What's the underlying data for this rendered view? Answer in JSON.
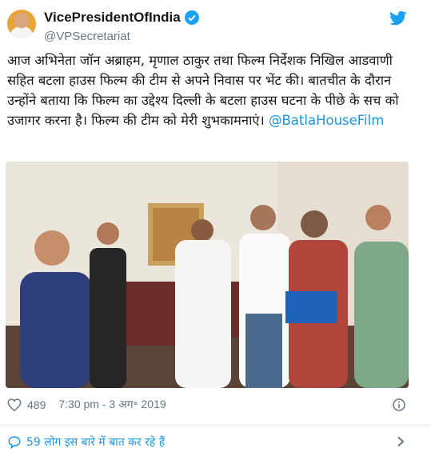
{
  "author": {
    "display_name": "VicePresidentOfIndia",
    "handle": "@VPSecretariat",
    "verified": true
  },
  "tweet": {
    "text": "आज अभिनेता जॉन अब्राहम, मृणाल ठाकुर तथा फिल्म निर्देशक निखिल आडवाणी सहित बटला हाउस फिल्म की टीम से अपने निवास पर भेंट की। बातचीत के दौरान उन्होंने बताया कि फिल्म का उद्देश्य दिल्ली के बटला हाउस घटना के पीछे के सच को उजागर करना है। फिल्म की टीम को मेरी शुभकामनाएं। ",
    "hashtag": "@BatlaHouseFilm"
  },
  "meta": {
    "likes": "489",
    "timestamp": "7:30 pm - 3 अग॰ 2019"
  },
  "conversation": {
    "label": "59 लोग इस बारे में बात कर रहे हैं"
  },
  "icons": {
    "brand": "twitter-bird-icon",
    "verified": "verified-badge-icon",
    "like": "heart-icon",
    "info": "info-icon",
    "conversation": "comment-icon",
    "chevron": "chevron-right-icon"
  },
  "colors": {
    "link_blue": "#1b95e0",
    "twitter_blue": "#1da1f2",
    "muted": "#657786"
  }
}
